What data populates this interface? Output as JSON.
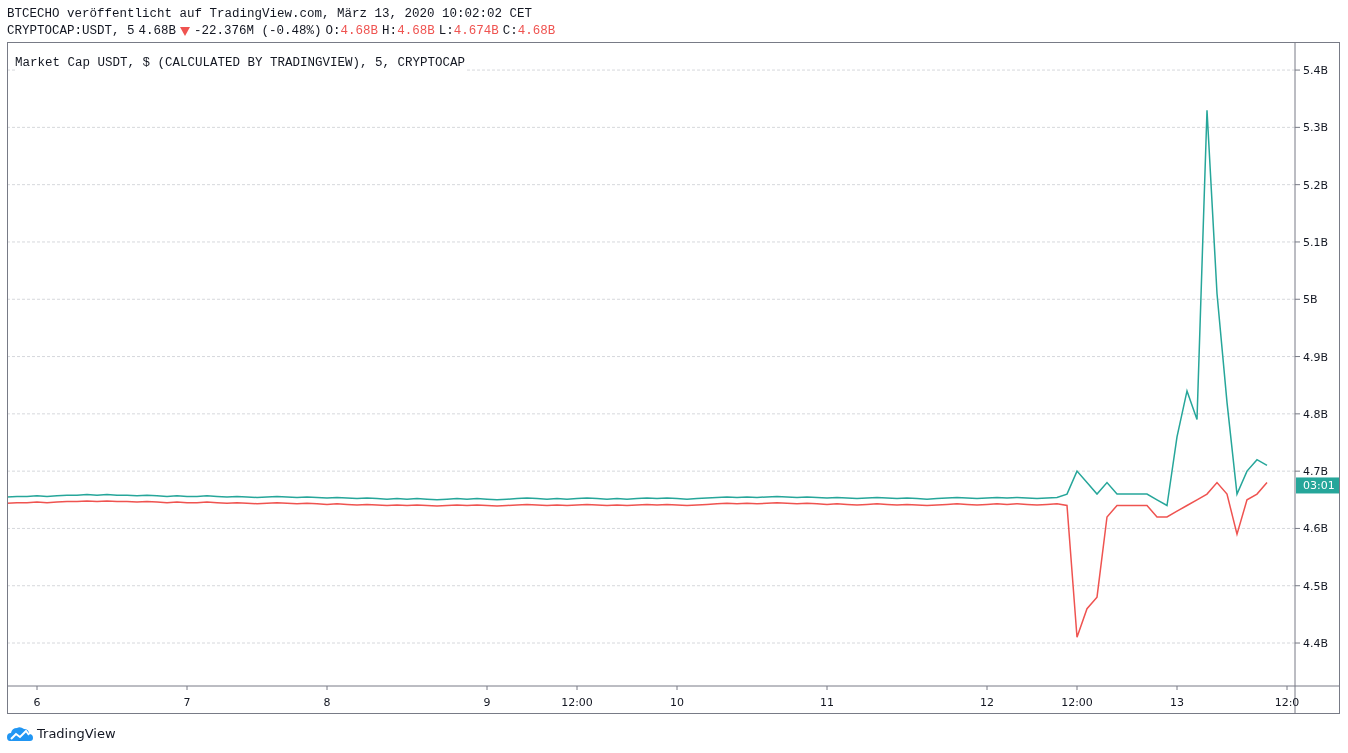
{
  "header": {
    "publisher_line": "BTCECHO veröffentlicht auf TradingView.com, März 13, 2020 10:02:02 CET",
    "symbol": "CRYPTOCAP:USDT, 5",
    "last": "4.68B",
    "change": "-22.376M (-0.48%)",
    "ohlc": [
      {
        "label": "O:",
        "value": "4.68B"
      },
      {
        "label": "H:",
        "value": "4.68B"
      },
      {
        "label": "L:",
        "value": "4.674B"
      },
      {
        "label": "C:",
        "value": "4.68B"
      }
    ]
  },
  "chart": {
    "legend": "Market Cap USDT, $ (CALCULATED BY TRADINGVIEW), 5, CRYPTOCAP",
    "chart_data": {
      "type": "line",
      "categories": [
        null,
        null,
        null,
        "6",
        null,
        null,
        null,
        null,
        null,
        null,
        null,
        null,
        null,
        null,
        null,
        null,
        null,
        null,
        "7",
        null,
        null,
        null,
        null,
        null,
        null,
        null,
        null,
        null,
        null,
        null,
        null,
        null,
        "8",
        null,
        null,
        null,
        null,
        null,
        null,
        null,
        null,
        null,
        null,
        null,
        null,
        null,
        null,
        null,
        "9",
        null,
        null,
        null,
        null,
        null,
        null,
        null,
        null,
        "12:00",
        null,
        null,
        null,
        null,
        null,
        null,
        null,
        null,
        null,
        "10",
        null,
        null,
        null,
        null,
        null,
        null,
        null,
        null,
        null,
        null,
        null,
        null,
        null,
        null,
        "11",
        null,
        null,
        null,
        null,
        null,
        null,
        null,
        null,
        null,
        null,
        null,
        null,
        null,
        null,
        null,
        "12",
        null,
        null,
        null,
        null,
        null,
        null,
        null,
        null,
        "12:00",
        null,
        null,
        null,
        null,
        null,
        null,
        null,
        null,
        null,
        "13",
        null,
        null,
        null,
        null,
        null,
        null,
        null,
        null,
        null,
        null,
        "12:0"
      ],
      "series": [
        {
          "color": "#26a69a",
          "values": [
            4.655,
            4.656,
            4.656,
            4.657,
            4.656,
            4.657,
            4.658,
            4.658,
            4.659,
            4.658,
            4.659,
            4.658,
            4.658,
            4.657,
            4.658,
            4.657,
            4.656,
            4.657,
            4.656,
            4.656,
            4.657,
            4.656,
            4.655,
            4.656,
            4.655,
            4.654,
            4.655,
            4.656,
            4.655,
            4.654,
            4.655,
            4.654,
            4.653,
            4.654,
            4.653,
            4.652,
            4.653,
            4.652,
            4.651,
            4.652,
            4.651,
            4.652,
            4.651,
            4.65,
            4.651,
            4.652,
            4.651,
            4.652,
            4.651,
            4.65,
            4.651,
            4.652,
            4.653,
            4.652,
            4.651,
            4.652,
            4.651,
            4.652,
            4.653,
            4.652,
            4.651,
            4.652,
            4.651,
            4.652,
            4.653,
            4.652,
            4.653,
            4.652,
            4.651,
            4.652,
            4.653,
            4.654,
            4.655,
            4.654,
            4.655,
            4.654,
            4.655,
            4.656,
            4.655,
            4.654,
            4.655,
            4.654,
            4.653,
            4.654,
            4.653,
            4.652,
            4.653,
            4.654,
            4.653,
            4.652,
            4.653,
            4.652,
            4.651,
            4.652,
            4.653,
            4.654,
            4.653,
            4.652,
            4.653,
            4.654,
            4.653,
            4.654,
            4.653,
            4.652,
            4.653,
            4.654,
            4.66,
            4.7,
            4.68,
            4.66,
            4.68,
            4.66,
            4.66,
            4.66,
            4.66,
            4.65,
            4.64,
            4.76,
            4.84,
            4.79,
            5.33,
            5.01,
            4.82,
            4.66,
            4.7,
            4.72,
            4.71,
            null,
            null
          ]
        },
        {
          "color": "#ef5350",
          "values": [
            4.644,
            4.645,
            4.645,
            4.646,
            4.645,
            4.646,
            4.647,
            4.647,
            4.648,
            4.647,
            4.648,
            4.647,
            4.647,
            4.646,
            4.647,
            4.646,
            4.645,
            4.646,
            4.645,
            4.645,
            4.646,
            4.645,
            4.644,
            4.645,
            4.644,
            4.643,
            4.644,
            4.645,
            4.644,
            4.643,
            4.644,
            4.643,
            4.642,
            4.643,
            4.642,
            4.641,
            4.642,
            4.641,
            4.64,
            4.641,
            4.64,
            4.641,
            4.64,
            4.639,
            4.64,
            4.641,
            4.64,
            4.641,
            4.64,
            4.639,
            4.64,
            4.641,
            4.642,
            4.641,
            4.64,
            4.641,
            4.64,
            4.641,
            4.642,
            4.641,
            4.64,
            4.641,
            4.64,
            4.641,
            4.642,
            4.641,
            4.642,
            4.641,
            4.64,
            4.641,
            4.642,
            4.643,
            4.644,
            4.643,
            4.644,
            4.643,
            4.644,
            4.645,
            4.644,
            4.643,
            4.644,
            4.643,
            4.642,
            4.643,
            4.642,
            4.641,
            4.642,
            4.643,
            4.642,
            4.641,
            4.642,
            4.641,
            4.64,
            4.641,
            4.642,
            4.643,
            4.642,
            4.641,
            4.642,
            4.643,
            4.642,
            4.643,
            4.642,
            4.641,
            4.642,
            4.643,
            4.64,
            4.41,
            4.46,
            4.48,
            4.62,
            4.64,
            4.64,
            4.64,
            4.64,
            4.62,
            4.62,
            4.63,
            4.64,
            4.65,
            4.66,
            4.68,
            4.66,
            4.59,
            4.65,
            4.66,
            4.68,
            null,
            null
          ]
        }
      ],
      "grid": true,
      "ylim": [
        4.325,
        5.449
      ],
      "yticks": [
        {
          "value": 4.4,
          "label": "4.4B"
        },
        {
          "value": 4.5,
          "label": "4.5B"
        },
        {
          "value": 4.6,
          "label": "4.6B"
        },
        {
          "value": 4.7,
          "label": "4.7B"
        },
        {
          "value": 4.8,
          "label": "4.8B"
        },
        {
          "value": 4.9,
          "label": "4.9B"
        },
        {
          "value": 5.0,
          "label": "5B"
        },
        {
          "value": 5.1,
          "label": "5.1B"
        },
        {
          "value": 5.2,
          "label": "5.2B"
        },
        {
          "value": 5.3,
          "label": "5.3B"
        },
        {
          "value": 5.4,
          "label": "5.4B"
        }
      ],
      "annotations": [
        {
          "y": 4.675,
          "text": "03:01"
        }
      ]
    }
  },
  "footer": {
    "logo_text": "TradingView"
  }
}
